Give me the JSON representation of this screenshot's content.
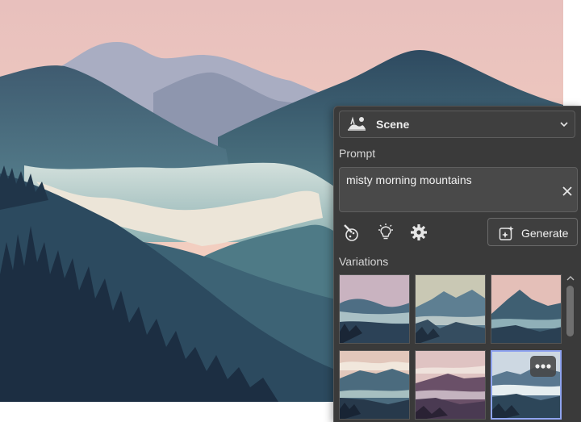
{
  "colors": {
    "sky_top": "#e8c0bd",
    "sky_bottom": "#f7d3c2",
    "panel_bg": "#3a3a3a",
    "selected_border": "#8fa4f0",
    "text": "#f2f2f2"
  },
  "panel": {
    "mode": {
      "label": "Scene",
      "icon": "scene-icon",
      "chevron": "chevron-down-icon"
    },
    "prompt": {
      "label": "Prompt",
      "value": "misty morning mountains",
      "clear_icon": "close-icon"
    },
    "tools": [
      "style-brush-icon",
      "lightbulb-icon",
      "gear-icon"
    ],
    "generate": {
      "label": "Generate",
      "icon": "generate-icon"
    },
    "variations": {
      "label": "Variations",
      "selected_index": 5,
      "items": [
        "variation-1",
        "variation-2",
        "variation-3",
        "variation-4",
        "variation-5",
        "variation-6"
      ],
      "more_icon": "more-options-icon"
    }
  }
}
